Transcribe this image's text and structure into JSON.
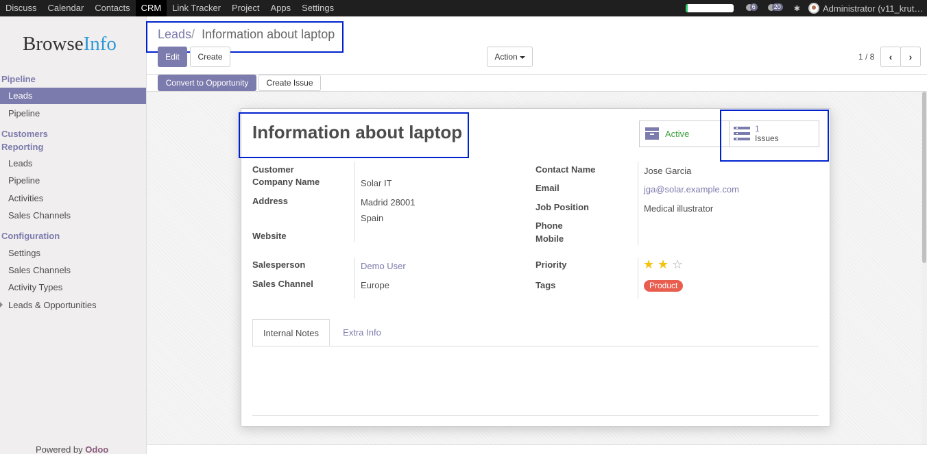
{
  "topbar": {
    "menu": [
      "Discuss",
      "Calendar",
      "Contacts",
      "CRM",
      "Link Tracker",
      "Project",
      "Apps",
      "Settings"
    ],
    "active": "CRM",
    "progress": 0.05,
    "activities_count": "6",
    "messages_count": "20",
    "user": "Administrator (v11_krut…"
  },
  "sidebar": {
    "logo_main": "Browse",
    "logo_accent": "Info",
    "sections": {
      "pipeline": "Pipeline",
      "customers": "Customers",
      "reporting": "Reporting",
      "configuration": "Configuration"
    },
    "pipeline_items": [
      "Leads",
      "Pipeline"
    ],
    "reporting_items": [
      "Leads",
      "Pipeline",
      "Activities",
      "Sales Channels"
    ],
    "config_items": [
      "Settings",
      "Sales Channels",
      "Activity Types",
      "Leads & Opportunities"
    ],
    "powered_prefix": "Powered by",
    "powered_brand": "Odoo"
  },
  "breadcrumb": {
    "parent": "Leads",
    "separator": "/",
    "current": "Information about laptop"
  },
  "buttons": {
    "edit": "Edit",
    "create": "Create",
    "action": "Action",
    "convert": "Convert to Opportunity",
    "create_issue": "Create Issue"
  },
  "pager": {
    "text": "1 / 8"
  },
  "form": {
    "title": "Information about laptop",
    "smart": {
      "active_label": "Active",
      "issues_count": "1",
      "issues_label": "Issues"
    },
    "labels": {
      "customer": "Customer",
      "company_name": "Company Name",
      "address": "Address",
      "website": "Website",
      "contact_name": "Contact Name",
      "email": "Email",
      "job_position": "Job Position",
      "phone": "Phone",
      "mobile": "Mobile",
      "salesperson": "Salesperson",
      "sales_channel": "Sales Channel",
      "priority": "Priority",
      "tags": "Tags"
    },
    "values": {
      "company_name": "Solar IT",
      "address_line1": "Madrid 28001",
      "address_line2": "Spain",
      "contact_name": "Jose Garcia",
      "email": "jga@solar.example.com",
      "job_position": "Medical illustrator",
      "salesperson": "Demo User",
      "sales_channel": "Europe",
      "priority_stars": 2,
      "priority_max": 3,
      "tag": "Product"
    },
    "tabs": [
      "Internal Notes",
      "Extra Info"
    ],
    "active_tab": "Internal Notes"
  },
  "colors": {
    "accent": "#7c7bad",
    "active_green": "#3f9f3f",
    "tag_red": "#e95d4f",
    "highlight_blue": "#0022cc"
  }
}
